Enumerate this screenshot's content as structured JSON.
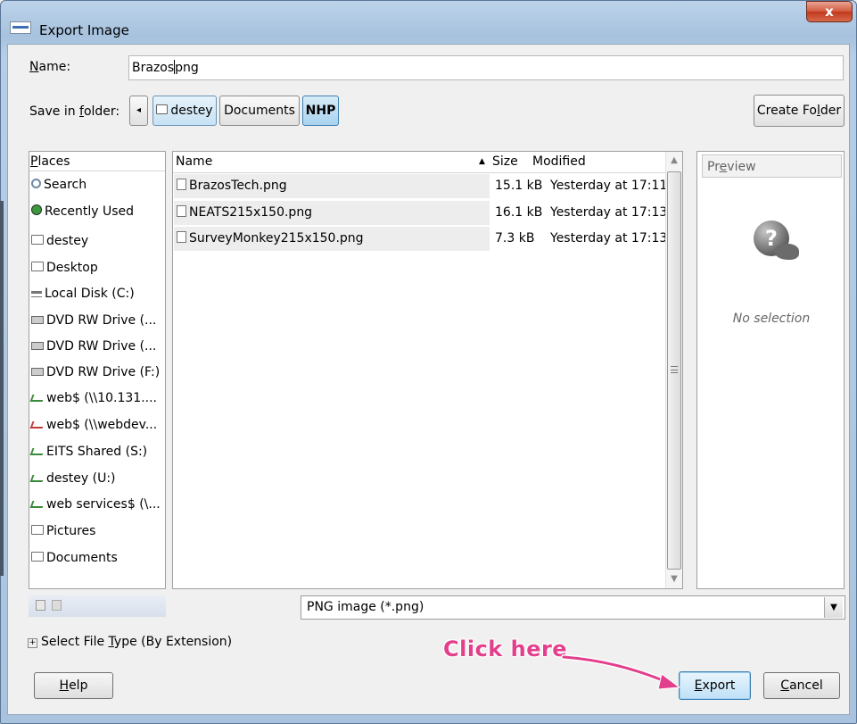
{
  "window": {
    "title": "Export Image",
    "close_glyph": "x"
  },
  "name_row": {
    "label_prefix": "N",
    "label_rest": "ame:",
    "value_before_caret": "Brazos",
    "value_after_caret": "png"
  },
  "folder_row": {
    "label_prefix": "Save in ",
    "label_underlined": "f",
    "label_rest": "older:",
    "back_glyph": "◂",
    "path": [
      "destey",
      "Documents",
      "NHP"
    ],
    "create_folder_prefix": "Create Fo",
    "create_folder_underlined": "l",
    "create_folder_rest": "der"
  },
  "places": {
    "header_prefix": "P",
    "header_rest": "laces",
    "items": [
      {
        "label": "Search",
        "icon": "search-icon"
      },
      {
        "label": "Recently Used",
        "icon": "recent-icon"
      },
      {
        "label": "destey",
        "icon": "folder-icon"
      },
      {
        "label": "Desktop",
        "icon": "folder-icon"
      },
      {
        "label": "Local Disk (C:)",
        "icon": "disk-icon"
      },
      {
        "label": "DVD RW Drive (...",
        "icon": "dvd-icon"
      },
      {
        "label": "DVD RW Drive (...",
        "icon": "dvd-icon"
      },
      {
        "label": "DVD RW Drive (F:)",
        "icon": "dvd-icon"
      },
      {
        "label": "web$ (\\\\10.131....",
        "icon": "network-drive-icon"
      },
      {
        "label": "web$ (\\\\webdev...",
        "icon": "network-drive-disconnected-icon"
      },
      {
        "label": "EITS Shared (S:)",
        "icon": "network-drive-icon"
      },
      {
        "label": "destey (U:)",
        "icon": "network-drive-icon"
      },
      {
        "label": "web services$ (\\...",
        "icon": "network-drive-icon"
      },
      {
        "label": "Pictures",
        "icon": "folder-icon"
      },
      {
        "label": "Documents",
        "icon": "folder-icon"
      }
    ]
  },
  "files": {
    "columns": {
      "name": "Name",
      "sort_glyph": "▲",
      "size": "Size",
      "modified": "Modified"
    },
    "rows": [
      {
        "name": "BrazosTech.png",
        "size": "15.1 kB",
        "modified": "Yesterday at 17:11"
      },
      {
        "name": "NEATS215x150.png",
        "size": "16.1 kB",
        "modified": "Yesterday at 17:13"
      },
      {
        "name": "SurveyMonkey215x150.png",
        "size": "7.3 kB",
        "modified": "Yesterday at 17:13"
      }
    ],
    "scroll_up_glyph": "▲",
    "scroll_down_glyph": "▼"
  },
  "preview": {
    "label_prefix": "Pr",
    "label_underlined": "e",
    "label_rest": "view",
    "question_glyph": "?",
    "empty_text": "No selection"
  },
  "file_type": {
    "selected": "PNG image (*.png)",
    "arrow_glyph": "▼"
  },
  "expander": {
    "glyph": "+",
    "label_prefix": "Select File ",
    "label_underlined": "T",
    "label_rest": "ype (By Extension)"
  },
  "buttons": {
    "help_underlined": "H",
    "help_rest": "elp",
    "export_underlined": "E",
    "export_rest": "xport",
    "cancel_underlined": "C",
    "cancel_rest": "ancel"
  },
  "annotation": {
    "text": "Click here",
    "color": "#e23f8c"
  }
}
